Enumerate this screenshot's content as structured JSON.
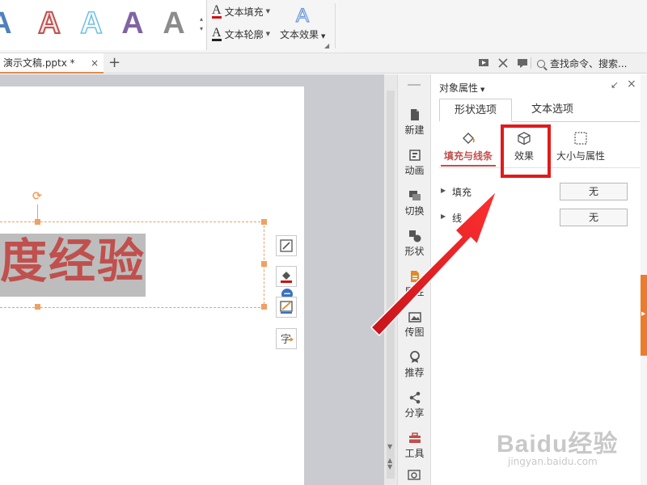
{
  "ribbon": {
    "text_style_gallery": [
      {
        "glyph": "A",
        "style": "blue-gradient"
      },
      {
        "glyph": "A",
        "style": "red-outline"
      },
      {
        "glyph": "A",
        "style": "light-blue-outline"
      },
      {
        "glyph": "A",
        "style": "purple"
      },
      {
        "glyph": "A",
        "style": "gray-gradient"
      }
    ],
    "text_fill": "文本填充",
    "text_outline": "文本轮廓",
    "text_effect": "文本效果",
    "effect_glyph": "A"
  },
  "tabbar": {
    "doc_tab": "演示文稿.pptx *",
    "close": "×",
    "new_tab": "+",
    "search": "查找命令、搜索..."
  },
  "slide": {
    "text": "度经验",
    "text_color": "#c0504d"
  },
  "sidebar": {
    "items": [
      {
        "label": "新建",
        "icon": "new-doc-icon"
      },
      {
        "label": "动画",
        "icon": "animation-icon"
      },
      {
        "label": "切换",
        "icon": "transition-icon"
      },
      {
        "label": "形状",
        "icon": "shapes-icon"
      },
      {
        "label": "属性",
        "icon": "properties-icon"
      },
      {
        "label": "传图",
        "icon": "upload-image-icon"
      },
      {
        "label": "推荐",
        "icon": "recommend-icon"
      },
      {
        "label": "分享",
        "icon": "share-icon"
      },
      {
        "label": "工具",
        "icon": "toolbox-icon"
      }
    ]
  },
  "panel": {
    "title": "对象属性",
    "tabs": {
      "shape": "形状选项",
      "text": "文本选项"
    },
    "subtabs": {
      "fill_line": "填充与线条",
      "effect": "效果",
      "size_props": "大小与属性"
    },
    "rows": [
      {
        "label": "填充",
        "value": "无"
      },
      {
        "label": "线",
        "value": "无"
      }
    ],
    "accent_color": "#c0504d",
    "highlight_color": "#e01b1b"
  },
  "watermark": {
    "main": "Baidu经验",
    "sub": "jingyan.baidu.com"
  }
}
